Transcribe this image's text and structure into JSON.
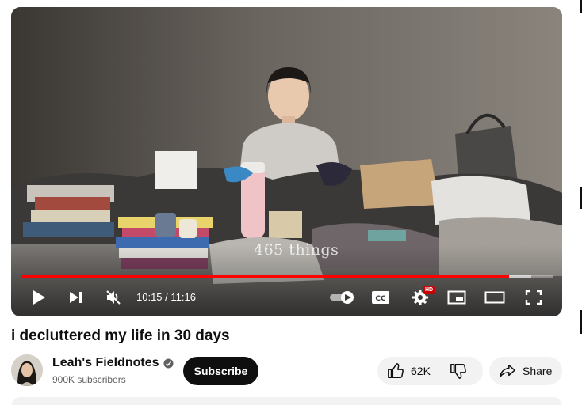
{
  "video": {
    "overlay_text": "465 things",
    "time_display": "10:15 / 11:16",
    "progress_fraction": 0.918,
    "buffered_fraction": 0.96,
    "hd_badge": "HD"
  },
  "title": "i decluttered my life in 30 days",
  "channel": {
    "name": "Leah's Fieldnotes",
    "subscribers": "900K subscribers",
    "subscribe_label": "Subscribe"
  },
  "actions": {
    "like_count": "62K",
    "share_label": "Share"
  },
  "colors": {
    "progress": "#ff0000",
    "subscribe_bg": "#0f0f0f",
    "pill_bg": "#f2f2f2"
  },
  "icons": {
    "play": "play-icon",
    "next": "next-icon",
    "mute": "volume-muted-icon",
    "autoplay": "autoplay-toggle-icon",
    "captions": "cc-icon",
    "settings": "gear-icon",
    "miniplayer": "miniplayer-icon",
    "theater": "theater-mode-icon",
    "fullscreen": "fullscreen-icon",
    "like": "thumbs-up-icon",
    "dislike": "thumbs-down-icon",
    "share": "share-arrow-icon",
    "verified": "verified-check-icon"
  }
}
